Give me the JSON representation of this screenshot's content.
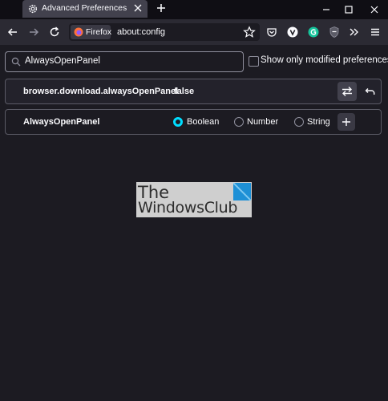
{
  "tab": {
    "title": "Advanced Preferences"
  },
  "toolbar": {
    "identity_label": "Firefox",
    "url": "about:config"
  },
  "search": {
    "value": "AlwaysOpenPanel"
  },
  "filter": {
    "show_modified_label": "Show only modified preferences"
  },
  "preferences": [
    {
      "name": "browser.download.alwaysOpenPanel",
      "value": "false"
    }
  ],
  "new_pref": {
    "name": "AlwaysOpenPanel",
    "types": [
      {
        "label": "Boolean",
        "selected": true
      },
      {
        "label": "Number",
        "selected": false
      },
      {
        "label": "String",
        "selected": false
      }
    ]
  },
  "watermark": {
    "line1": "The",
    "line2": "WindowsClub"
  },
  "colors": {
    "accent": "#00ddff",
    "background": "#1c1b22",
    "toolbar": "#2b2a33"
  }
}
